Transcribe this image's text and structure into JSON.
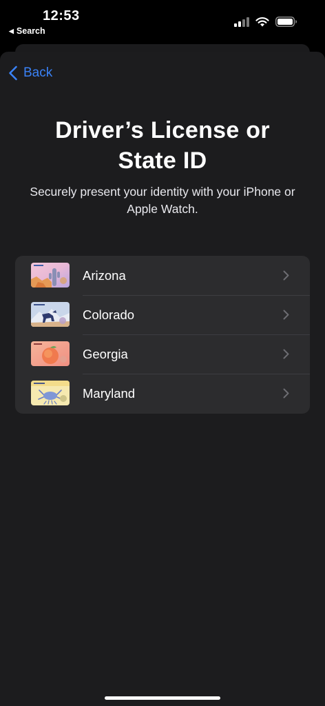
{
  "status_bar": {
    "time": "12:53",
    "back_app_label": "Search",
    "icons": [
      "cellular-signal-icon",
      "wifi-icon",
      "battery-icon"
    ]
  },
  "nav": {
    "back_label": "Back",
    "accent_color": "#3a82f7"
  },
  "page": {
    "title_line1": "Driver’s License or",
    "title_line2": "State ID",
    "subtitle_line1": "Securely present your identity with your iPhone or",
    "subtitle_line2": "Apple Watch."
  },
  "states": [
    {
      "name": "Arizona",
      "thumb_icon": "arizona-license-card-icon"
    },
    {
      "name": "Colorado",
      "thumb_icon": "colorado-license-card-icon"
    },
    {
      "name": "Georgia",
      "thumb_icon": "georgia-license-card-icon"
    },
    {
      "name": "Maryland",
      "thumb_icon": "maryland-license-card-icon"
    }
  ]
}
